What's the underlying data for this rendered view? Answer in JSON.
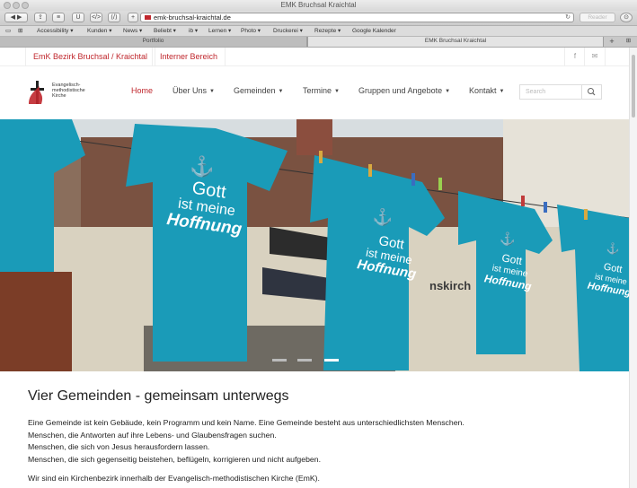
{
  "window": {
    "title": "EMK Bruchsal Kraichtal"
  },
  "toolbar": {
    "url": "emk-bruchsal-kraichtal.de",
    "reader_label": "Reader"
  },
  "bookmarks": [
    "Accessibility ▾",
    "Kunden ▾",
    "News ▾",
    "Beliebt ▾",
    "ib ▾",
    "Lernen ▾",
    "Photo ▾",
    "Druckerei ▾",
    "Rezepte ▾",
    "Google Kalender"
  ],
  "tabs": {
    "inactive": "Portfolio",
    "active": "EMK Bruchsal Kraichtal"
  },
  "site": {
    "top_links": [
      "EmK Bezirk Bruchsal / Kraichtal",
      "Interner Bereich"
    ],
    "logo_text": [
      "Evangelisch-",
      "methodistische",
      "Kirche"
    ],
    "nav": [
      {
        "label": "Home",
        "has_dropdown": false
      },
      {
        "label": "Über Uns",
        "has_dropdown": true
      },
      {
        "label": "Gemeinden",
        "has_dropdown": true
      },
      {
        "label": "Termine",
        "has_dropdown": true
      },
      {
        "label": "Gruppen und Angebote",
        "has_dropdown": true
      },
      {
        "label": "Kontakt",
        "has_dropdown": true
      }
    ],
    "search_placeholder": "Search",
    "hero": {
      "shirt_text": [
        "Gott",
        "ist meine",
        "Hoffnung"
      ],
      "sign_text": "nskirch"
    },
    "heading": "Vier Gemeinden - gemeinsam unterwegs",
    "paragraph_lines": [
      "Eine Gemeinde ist kein Gebäude, kein Programm und kein Name. Eine Gemeinde besteht aus unterschiedlichsten Menschen.",
      "Menschen, die Antworten auf ihre Lebens- und Glaubensfragen suchen.",
      "Menschen, die sich von Jesus herausfordern lassen.",
      "Menschen, die sich gegenseitig beistehen, beflügeln, korrigieren und nicht aufgeben."
    ],
    "paragraph2": "Wir sind ein Kirchenbezirk innerhalb der Evangelisch-methodistischen Kirche (EmK).",
    "colors": {
      "accent": "#c0272d",
      "shirt": "#1a9bb8"
    }
  }
}
